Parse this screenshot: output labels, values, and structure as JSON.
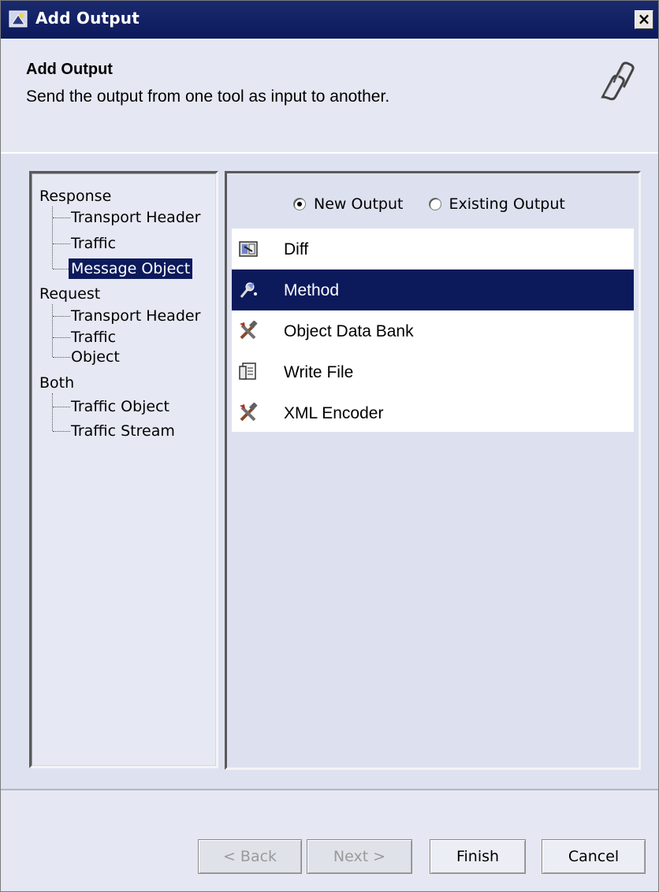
{
  "window": {
    "title": "Add Output",
    "close_label": "×"
  },
  "header": {
    "title": "Add Output",
    "subtitle": "Send the output from one tool as input to another."
  },
  "tree": {
    "groups": [
      {
        "label": "Response",
        "children": [
          "Transport Header",
          "Traffic",
          "Message Object"
        ]
      },
      {
        "label": "Request",
        "children": [
          "Transport Header",
          "Traffic",
          "Object"
        ]
      },
      {
        "label": "Both",
        "children": [
          "Traffic Object",
          "Traffic Stream"
        ]
      }
    ],
    "selected": "Response > Message Object"
  },
  "output_mode": {
    "options": [
      "New Output",
      "Existing Output"
    ],
    "selected": "New Output"
  },
  "tools": [
    {
      "label": "Diff",
      "icon": "diff-icon"
    },
    {
      "label": "Method",
      "icon": "method-icon"
    },
    {
      "label": "Object Data Bank",
      "icon": "tools-icon"
    },
    {
      "label": "Write File",
      "icon": "write-file-icon"
    },
    {
      "label": "XML Encoder",
      "icon": "tools-icon"
    }
  ],
  "selected_tool": "Method",
  "buttons": {
    "back": "< Back",
    "next": "Next >",
    "finish": "Finish",
    "cancel": "Cancel"
  },
  "colors": {
    "selection": "#0c1a5c",
    "titlebar": "#1b2a6e"
  }
}
